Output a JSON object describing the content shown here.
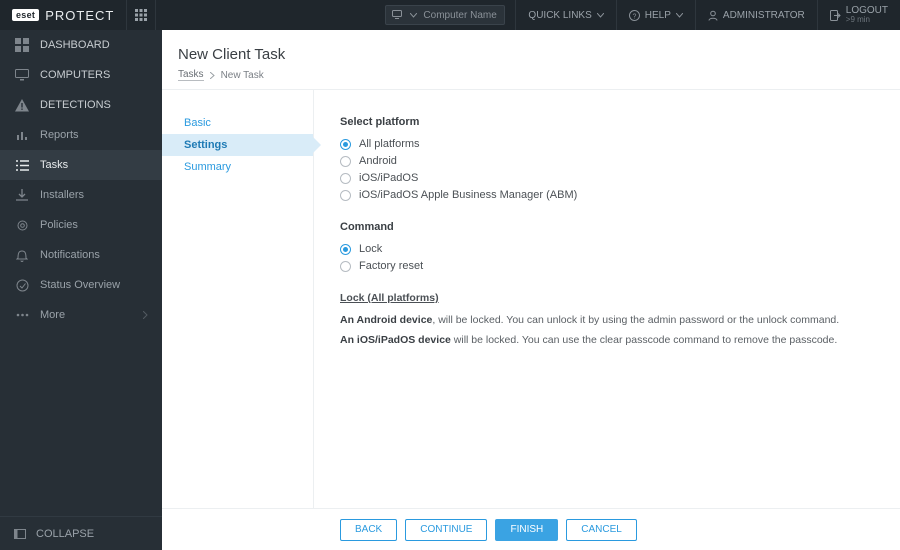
{
  "brand": {
    "badge": "eset",
    "name": "PROTECT"
  },
  "topbar": {
    "search_placeholder": "Computer Name",
    "quick_links": "QUICK LINKS",
    "help": "HELP",
    "admin": "ADMINISTRATOR",
    "logout": "LOGOUT",
    "logout_sub": ">9 min"
  },
  "sidebar": {
    "items": [
      {
        "label": "DASHBOARD"
      },
      {
        "label": "COMPUTERS"
      },
      {
        "label": "DETECTIONS"
      },
      {
        "label": "Reports"
      },
      {
        "label": "Tasks"
      },
      {
        "label": "Installers"
      },
      {
        "label": "Policies"
      },
      {
        "label": "Notifications"
      },
      {
        "label": "Status Overview"
      },
      {
        "label": "More"
      }
    ],
    "collapse": "COLLAPSE"
  },
  "page": {
    "title": "New Client Task",
    "crumb_root": "Tasks",
    "crumb_current": "New Task"
  },
  "steps": {
    "basic": "Basic",
    "settings": "Settings",
    "summary": "Summary"
  },
  "form": {
    "platform_title": "Select platform",
    "platforms": {
      "all": "All platforms",
      "android": "Android",
      "ios": "iOS/iPadOS",
      "abm": "iOS/iPadOS Apple Business Manager (ABM)"
    },
    "command_title": "Command",
    "commands": {
      "lock": "Lock",
      "factory": "Factory reset"
    },
    "desc_head": "Lock (All platforms)",
    "desc_android_b": "An Android device",
    "desc_android_r": ", will be locked. You can unlock it by using the admin password or the unlock command.",
    "desc_ios_b": "An iOS/iPadOS device",
    "desc_ios_r": " will be locked. You can use the clear passcode command to remove the passcode."
  },
  "footer": {
    "back": "BACK",
    "continue": "CONTINUE",
    "finish": "FINISH",
    "cancel": "CANCEL"
  }
}
